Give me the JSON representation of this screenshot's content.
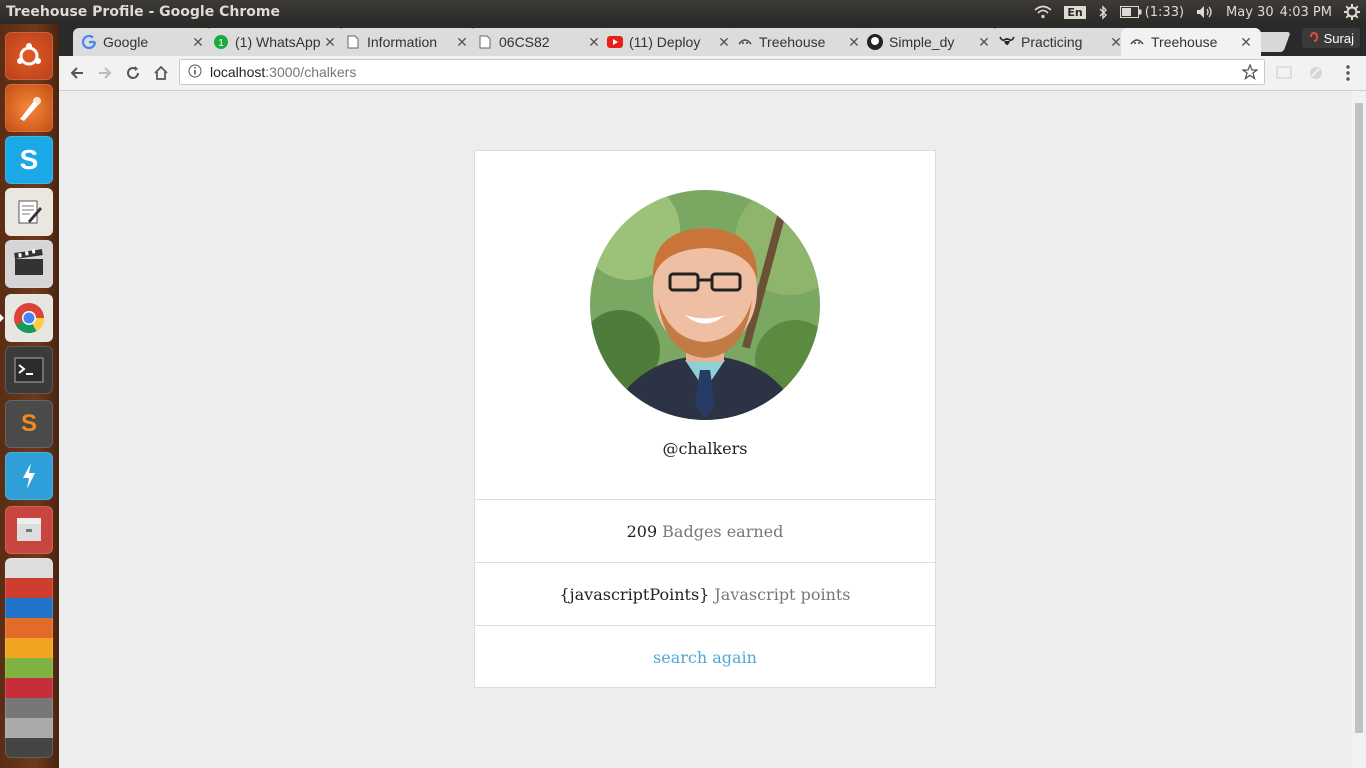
{
  "window": {
    "title": "Treehouse Profile - Google Chrome"
  },
  "tray": {
    "keyboard": "En",
    "battery": "(1:33)",
    "date": "May 30",
    "time": "4:03 PM"
  },
  "launcher": {
    "icons": [
      "ubuntu-icon",
      "inkscape-icon",
      "skype-icon",
      "text-editor-icon",
      "video-editor-icon",
      "chrome-icon",
      "terminal-icon",
      "sublime-icon",
      "power-icon",
      "files-icon",
      "stacked-apps-icon"
    ]
  },
  "tabs": [
    {
      "label": "Google",
      "icon": "google-icon"
    },
    {
      "label": "(1) WhatsApp",
      "icon": "whatsapp-icon"
    },
    {
      "label": "Information",
      "icon": "document-icon"
    },
    {
      "label": "06CS82",
      "icon": "document-icon"
    },
    {
      "label": "(11) Deploy",
      "icon": "youtube-icon"
    },
    {
      "label": "Treehouse",
      "icon": "treehouse-icon"
    },
    {
      "label": "Simple_dy",
      "icon": "github-icon"
    },
    {
      "label": "Practicing",
      "icon": "bull-icon"
    },
    {
      "label": "Treehouse",
      "icon": "treehouse-icon"
    }
  ],
  "profile": {
    "name": "Suraj"
  },
  "omnibox": {
    "host": "localhost",
    "path": ":3000/chalkers"
  },
  "card": {
    "username": "@chalkers",
    "badges_count": "209",
    "badges_label": "Badges earned",
    "js_points": "{javascriptPoints}",
    "js_label": "Javascript points",
    "search_again": "search again"
  },
  "colors": {
    "link": "#4fa9d6",
    "launcher": "#6e3a1c",
    "page_bg": "#ecedef"
  }
}
